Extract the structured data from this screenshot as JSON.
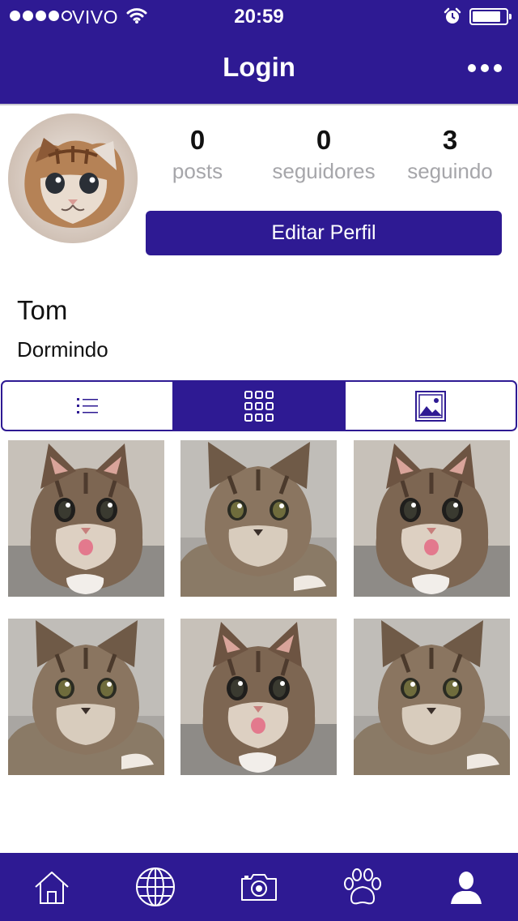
{
  "status_bar": {
    "carrier": "VIVO",
    "time": "20:59"
  },
  "nav": {
    "title": "Login",
    "more_icon": "more-dots-icon"
  },
  "profile": {
    "avatar_alt": "kitten avatar",
    "stats": [
      {
        "value": "0",
        "label": "posts"
      },
      {
        "value": "0",
        "label": "seguidores"
      },
      {
        "value": "3",
        "label": "seguindo"
      }
    ],
    "edit_button": "Editar Perfil",
    "name": "Tom",
    "bio": "Dormindo"
  },
  "view_toggle": {
    "options": [
      "list-view-icon",
      "grid-view-icon",
      "media-view-icon"
    ],
    "selected": "grid-view-icon"
  },
  "tab_bar": [
    "home-icon",
    "globe-icon",
    "camera-icon",
    "paw-icon",
    "profile-icon"
  ],
  "colors": {
    "brand": "#2e1a93",
    "label_gray": "#a6a6aa",
    "white": "#ffffff"
  }
}
